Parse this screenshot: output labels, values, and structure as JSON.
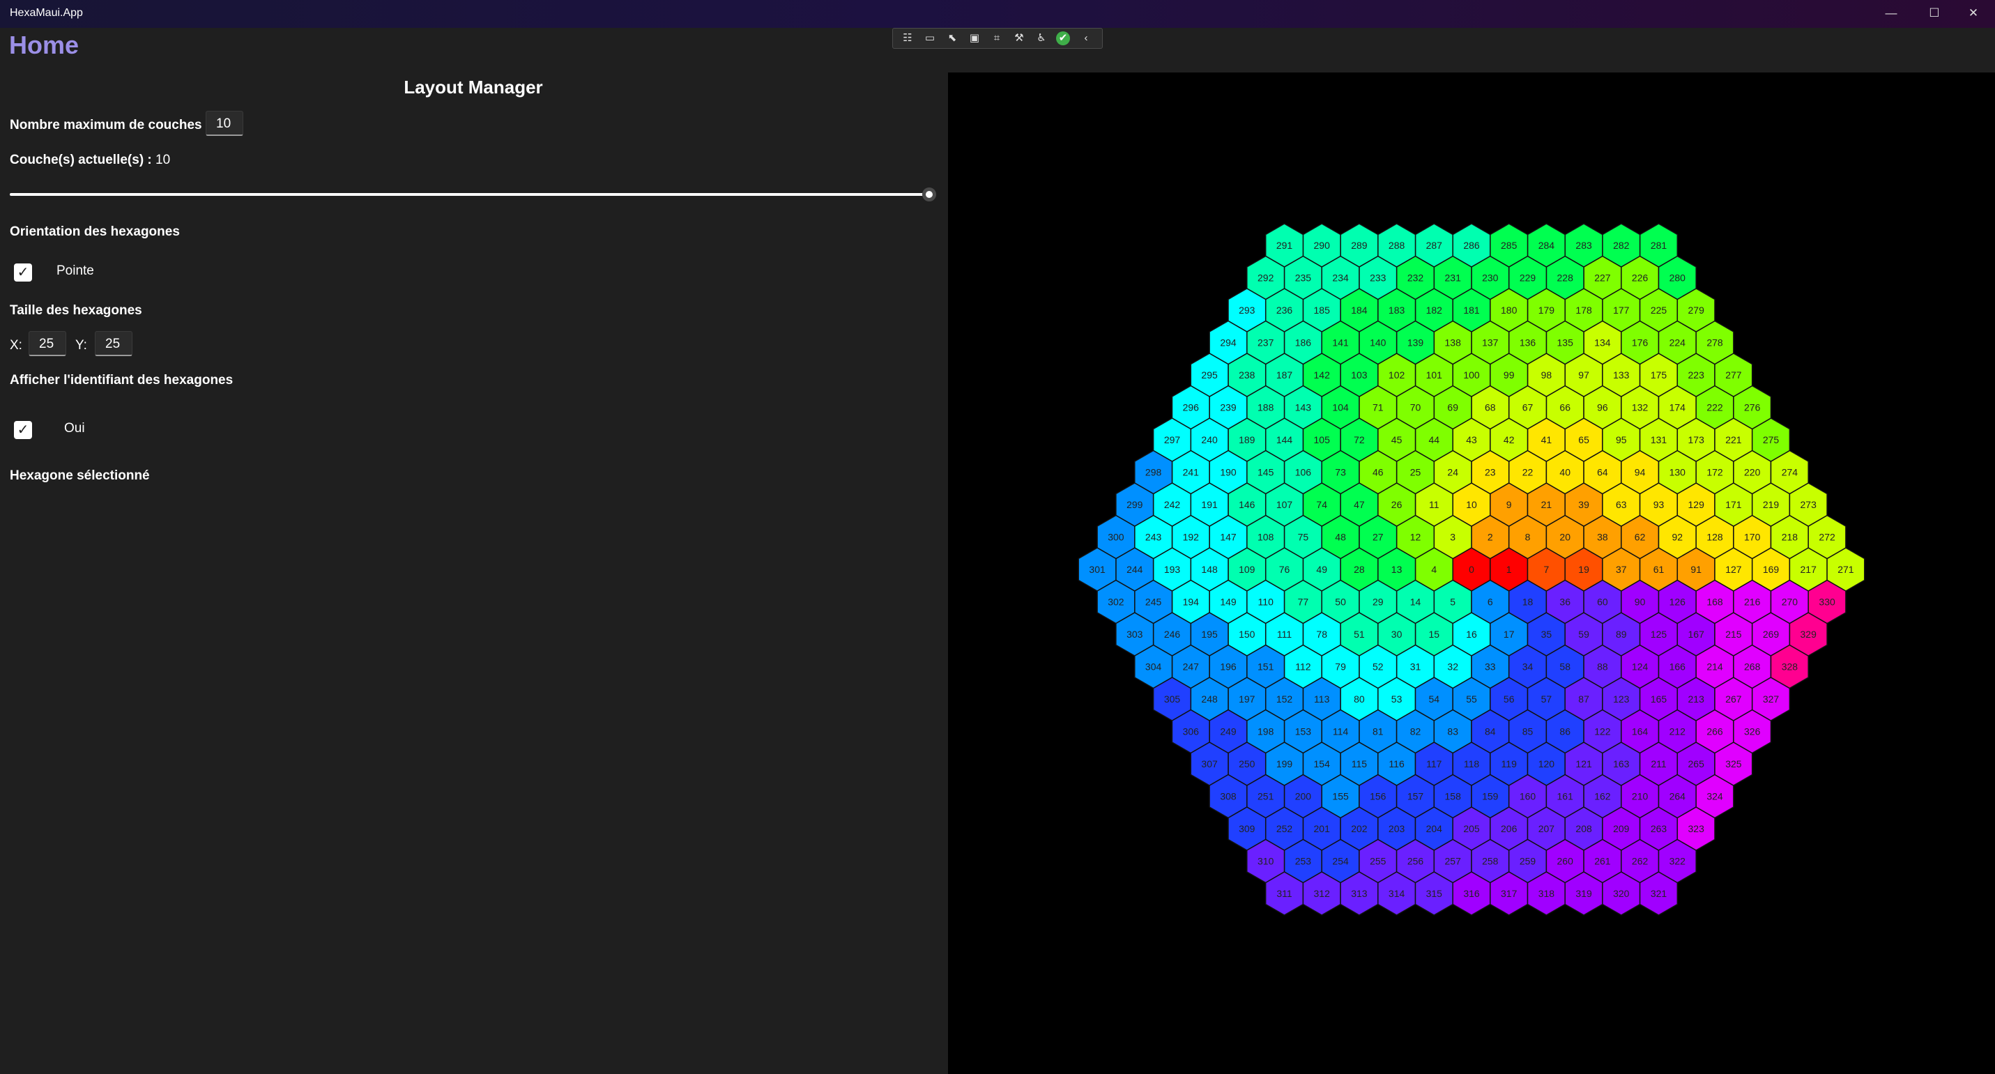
{
  "window": {
    "title": "HexaMaui.App",
    "minimize_icon": "—",
    "maximize_icon": "☐",
    "close_icon": "✕"
  },
  "page": {
    "title": "Home"
  },
  "debug_toolbar": {
    "icons": [
      "live-tree-icon",
      "record-icon",
      "select-element-icon",
      "display-layout-adorners-icon",
      "track-focus-icon",
      "binding-failures-icon",
      "accessibility-icon",
      "checkmark-icon",
      "collapse-chevron-icon"
    ],
    "glyphs": [
      "☷",
      "▭",
      "⬉",
      "▣",
      "⌗",
      "⚒",
      "♿",
      "✔",
      "‹"
    ]
  },
  "layout_manager": {
    "heading": "Layout Manager",
    "max_layers_label": "Nombre maximum de couches :",
    "max_layers_value": "10",
    "current_layers_label": "Couche(s) actuelle(s) :",
    "current_layers_value": "10",
    "slider_fraction": 1.0,
    "orientation_label": "Orientation des hexagones",
    "orientation_option": "Pointe",
    "orientation_checked": true,
    "size_label": "Taille des hexagones",
    "size_x_label": "X:",
    "size_x_value": "25",
    "size_y_label": "Y:",
    "size_y_value": "25",
    "show_id_label": "Afficher l'identifiant des hexagones",
    "show_id_option": "Oui",
    "show_id_checked": true,
    "selected_label": "Hexagone sélectionné"
  },
  "hex_grid": {
    "layers": 10,
    "orientation": "pointy",
    "show_ids": true,
    "id_rule": "spiral numbering from 0 at the center, layer by layer (labels 0–330)",
    "colors": [
      "#ff0000",
      "#ff5000",
      "#ffa000",
      "#ffe600",
      "#c8ff00",
      "#7fff00",
      "#00ff50",
      "#00ffb0",
      "#00ffff",
      "#0090ff",
      "#2040ff",
      "#6a20ff",
      "#a000ff",
      "#e000ff",
      "#ff0090"
    ]
  }
}
